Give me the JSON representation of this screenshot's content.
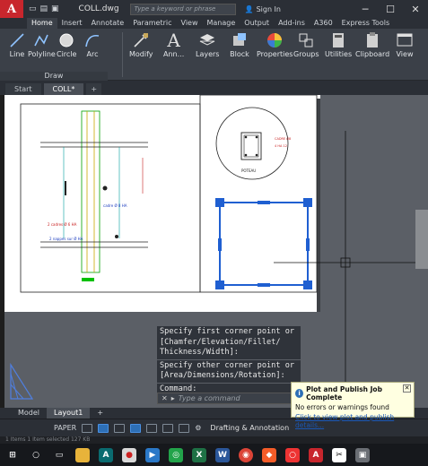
{
  "app": {
    "logo_letter": "A",
    "document_title": "COLL.dwg",
    "search_placeholder": "Type a keyword or phrase",
    "sign_in_label": "Sign In"
  },
  "ribbon_tabs": [
    "Home",
    "Insert",
    "Annotate",
    "Parametric",
    "View",
    "Manage",
    "Output",
    "Add-ins",
    "A360",
    "Express Tools"
  ],
  "ribbon_tools": [
    {
      "label": "Line",
      "icon": "line-icon"
    },
    {
      "label": "Polyline",
      "icon": "polyline-icon"
    },
    {
      "label": "Circle",
      "icon": "circle-icon"
    },
    {
      "label": "Arc",
      "icon": "arc-icon"
    },
    {
      "label": "Modify",
      "icon": "modify-icon"
    },
    {
      "label": "Ann...",
      "icon": "annotation-icon"
    },
    {
      "label": "Layers",
      "icon": "layers-icon"
    },
    {
      "label": "Block",
      "icon": "block-icon"
    },
    {
      "label": "Properties",
      "icon": "properties-icon"
    },
    {
      "label": "Groups",
      "icon": "groups-icon"
    },
    {
      "label": "Utilities",
      "icon": "utilities-icon"
    },
    {
      "label": "Clipboard",
      "icon": "clipboard-icon"
    },
    {
      "label": "View",
      "icon": "view-icon"
    }
  ],
  "draw_panel_label": "Draw",
  "doc_tabs": [
    {
      "label": "Start"
    },
    {
      "label": "COLL*"
    }
  ],
  "command_history": [
    "Specify first corner point or [Chamfer/Elevation/Fillet/ Thickness/Width]:",
    "Specify other corner point or [Area/Dimensions/Rotation]:",
    "Command:"
  ],
  "command_placeholder": "Type a command",
  "layout_tabs": [
    "Model",
    "Layout1"
  ],
  "status": {
    "space": "PAPER",
    "workspace": "Drafting & Annotation",
    "status_line": "1 Items  1 Item selected  127 KB"
  },
  "notification": {
    "title": "Plot and Publish Job Complete",
    "body": "No errors or warnings found",
    "link": "Click to view plot and publish details..."
  },
  "drawing_labels": {
    "caption": "POTEAU"
  },
  "colors": {
    "app_red": "#c8262d",
    "select_blue": "#1f5fd1",
    "ribbon_bg": "#3b4048"
  }
}
